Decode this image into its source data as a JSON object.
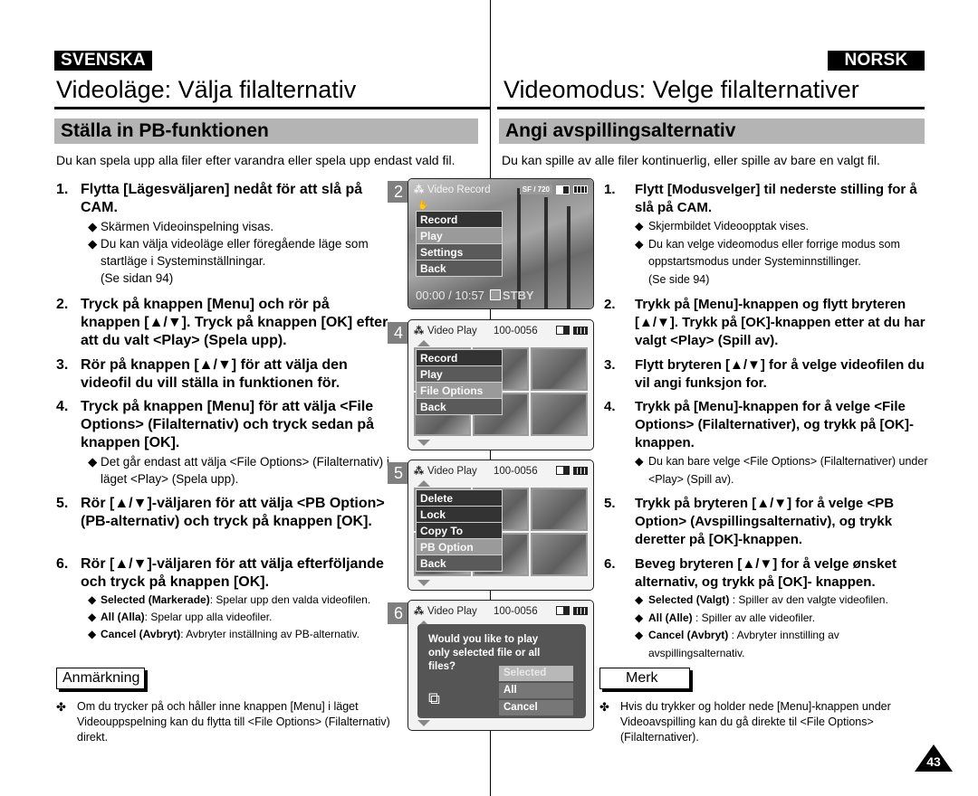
{
  "left": {
    "language": "SVENSKA",
    "title": "Videoläge: Välja filalternativ",
    "section": "Ställa in PB-funktionen",
    "intro": "Du kan spela upp alla filer efter varandra eller spela upp endast vald fil.",
    "steps": [
      {
        "num": "1.",
        "text": "Flytta [Lägesväljaren] nedåt för att slå på CAM.",
        "subs": [
          "Skärmen Videoinspelning visas.",
          "Du kan välja videoläge eller föregående läge som startläge i Systeminställningar.",
          "(Se sidan 94)"
        ]
      },
      {
        "num": "2.",
        "text": "Tryck på knappen [Menu] och rör på knappen [▲/▼]. Tryck på knappen [OK] efter att du valt <Play> (Spela upp)."
      },
      {
        "num": "3.",
        "text": "Rör på knappen [▲/▼] för att välja den videofil du vill ställa in funktionen för."
      },
      {
        "num": "4.",
        "text": "Tryck på knappen [Menu] för att välja <File Options> (Filalternativ) och tryck sedan på knappen [OK].",
        "subs": [
          "Det går endast att välja <File Options> (Filalternativ) i läget <Play> (Spela upp)."
        ]
      },
      {
        "num": "5.",
        "text": "Rör [▲/▼]-väljaren för att välja <PB Option> (PB-alternativ) och tryck på knappen [OK]."
      },
      {
        "num": "6.",
        "text": "Rör [▲/▼]-väljaren för att välja efterföljande och tryck på knappen [OK].",
        "options": [
          {
            "term": "Selected (Markerade)",
            "desc": ": Spelar upp den valda videofilen."
          },
          {
            "term": "All (Alla)",
            "desc": ": Spelar upp alla videofiler."
          },
          {
            "term": "Cancel (Avbryt)",
            "desc": ": Avbryter inställning av PB-alternativ."
          }
        ]
      }
    ],
    "note_label": "Anmärkning",
    "note_text": "Om du trycker på och håller inne knappen [Menu] i läget Videouppspelning kan du flytta till <File Options> (Filalternativ) direkt."
  },
  "right": {
    "language": "NORSK",
    "title": "Videomodus: Velge filalternativer",
    "section": "Angi avspillingsalternativ",
    "intro": "Du kan spille av alle filer kontinuerlig, eller spille av bare en valgt fil.",
    "steps": [
      {
        "num": "1.",
        "text": "Flytt [Modusvelger] til nederste stilling  for å slå på CAM.",
        "subs": [
          "Skjermbildet Videoopptak vises.",
          "Du kan velge videomodus eller forrige modus som oppstartsmodus under Systeminnstillinger.",
          "(Se side 94)"
        ]
      },
      {
        "num": "2.",
        "text": "Trykk på [Menu]-knappen og flytt bryteren [▲/▼]. Trykk på [OK]-knappen etter at du har valgt <Play> (Spill av)."
      },
      {
        "num": "3.",
        "text": "Flytt bryteren [▲/▼] for å velge videofilen du vil angi funksjon for."
      },
      {
        "num": "4.",
        "text": "Trykk på [Menu]-knappen for å velge <File Options> (Filalternativer), og trykk på [OK]-knappen.",
        "subs": [
          "Du kan bare velge <File Options> (Filalternativer) under <Play> (Spill av)."
        ]
      },
      {
        "num": "5.",
        "text": "Trykk på bryteren [▲/▼] for å velge <PB Option> (Avspillingsalternativ), og trykk deretter på [OK]-knappen."
      },
      {
        "num": "6.",
        "text": "Beveg bryteren [▲/▼] for å velge ønsket alternativ, og trykk på [OK]-  knappen.",
        "options": [
          {
            "term": "Selected (Valgt)",
            "desc": " : Spiller av den valgte videofilen."
          },
          {
            "term": "All (Alle)",
            "desc": " : Spiller av alle videofiler."
          },
          {
            "term": "Cancel (Avbryt)",
            "desc": " : Avbryter innstilling av avspillingsalternativ."
          }
        ]
      }
    ],
    "note_label": "Merk",
    "note_text": "Hvis du trykker og holder nede [Menu]-knappen under Videoavspilling kan du gå direkte til <File Options> (Filalternativer)."
  },
  "screens": [
    {
      "step": "2",
      "header": "Video Record",
      "badge_quality": "SF",
      "badge_res": "720",
      "menu": [
        "Record",
        "Play",
        "Settings",
        "Back"
      ],
      "selected": "Play",
      "counter": "00:00 / 10:57",
      "status": "STBY"
    },
    {
      "step": "4",
      "header": "Video Play",
      "file_no": "100-0056",
      "menu": [
        "Record",
        "Play",
        "File Options",
        "Back"
      ],
      "selected": "File Options"
    },
    {
      "step": "5",
      "header": "Video Play",
      "file_no": "100-0056",
      "menu": [
        "Delete",
        "Lock",
        "Copy To",
        "PB Option",
        "Back"
      ],
      "selected": "PB Option"
    },
    {
      "step": "6",
      "header": "Video Play",
      "file_no": "100-0056",
      "dialog": "Would you like to play only selected file or all files?",
      "options": [
        "Selected",
        "All",
        "Cancel"
      ],
      "selected": "Selected"
    }
  ],
  "icons": {
    "bullet": "◆",
    "note_bullet": "✤",
    "camera": "camcorder-icon",
    "doc": "document-icon"
  },
  "page_number": "43"
}
